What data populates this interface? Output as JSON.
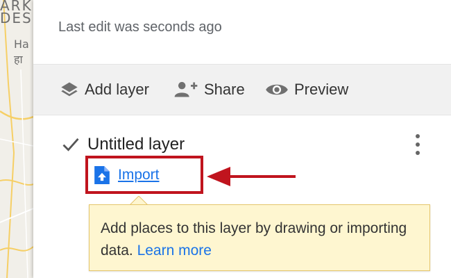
{
  "map": {
    "label_lines": [
      "ARK",
      "DES",
      "Ha",
      "हा"
    ]
  },
  "panel": {
    "subtitle": "Last edit was seconds ago"
  },
  "toolbar": {
    "add_layer": {
      "label": "Add layer",
      "icon": "layers-icon"
    },
    "share": {
      "label": "Share",
      "icon": "add-person-icon"
    },
    "preview": {
      "label": "Preview",
      "icon": "eye-icon"
    }
  },
  "layer": {
    "name": "Untitled layer",
    "checked": true,
    "import_label": "Import",
    "import_icon": "upload-file-icon",
    "menu_icon": "more-vert-icon"
  },
  "tooltip": {
    "text": "Add places to this layer by drawing or importing data.",
    "link": "Learn more"
  },
  "colors": {
    "highlight": "#c0141e",
    "link": "#1a73e8",
    "tooltip_bg": "#fef6d0"
  }
}
